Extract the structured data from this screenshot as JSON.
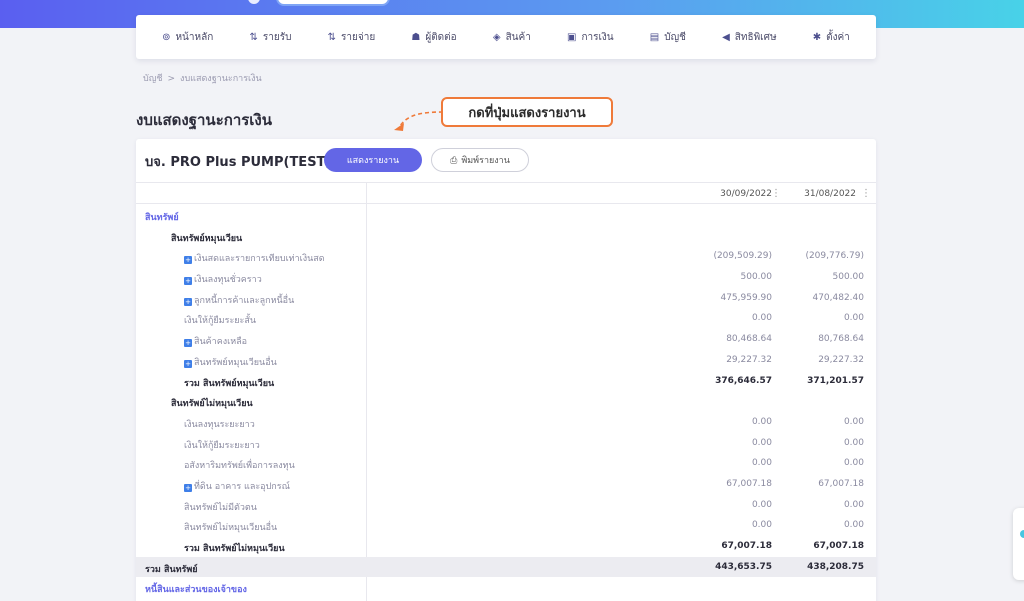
{
  "nav": [
    {
      "icon": "⊚",
      "label": "หน้าหลัก"
    },
    {
      "icon": "⇅",
      "label": "รายรับ"
    },
    {
      "icon": "⇅",
      "label": "รายจ่าย"
    },
    {
      "icon": "☗",
      "label": "ผู้ติดต่อ"
    },
    {
      "icon": "◈",
      "label": "สินค้า"
    },
    {
      "icon": "▣",
      "label": "การเงิน"
    },
    {
      "icon": "▤",
      "label": "บัญชี"
    },
    {
      "icon": "◀",
      "label": "สิทธิพิเศษ"
    },
    {
      "icon": "✱",
      "label": "ตั้งค่า"
    }
  ],
  "breadcrumb": {
    "root": "บัญชี",
    "sep": ">",
    "current": "งบแสดงฐานะการเงิน"
  },
  "page_title": "งบแสดงฐานะการเงิน",
  "callout": "กดที่ปุ่มแสดงรายงาน",
  "company": "บจ. PRO Plus PUMP(TEST)",
  "buttons": {
    "show": "แสดงรายงาน",
    "print": "พิมพ์รายงาน"
  },
  "columns": [
    "30/09/2022",
    "31/08/2022"
  ],
  "kebab": "⋮",
  "rows": [
    {
      "type": "lvl0",
      "label": "สินทรัพย์",
      "v1": "",
      "v2": ""
    },
    {
      "type": "lvl1",
      "label": "สินทรัพย์หมุนเวียน",
      "v1": "",
      "v2": ""
    },
    {
      "type": "lvl2",
      "plus": true,
      "label": "เงินสดและรายการเทียบเท่าเงินสด",
      "v1": "(209,509.29)",
      "v2": "(209,776.79)"
    },
    {
      "type": "lvl2",
      "plus": true,
      "label": "เงินลงทุนชั่วคราว",
      "v1": "500.00",
      "v2": "500.00"
    },
    {
      "type": "lvl2",
      "plus": true,
      "label": "ลูกหนี้การค้าและลูกหนี้อื่น",
      "v1": "475,959.90",
      "v2": "470,482.40"
    },
    {
      "type": "lvl2",
      "plus": false,
      "label": "เงินให้กู้ยืมระยะสั้น",
      "v1": "0.00",
      "v2": "0.00"
    },
    {
      "type": "lvl2",
      "plus": true,
      "label": "สินค้าคงเหลือ",
      "v1": "80,468.64",
      "v2": "80,768.64"
    },
    {
      "type": "lvl2",
      "plus": true,
      "label": "สินทรัพย์หมุนเวียนอื่น",
      "v1": "29,227.32",
      "v2": "29,227.32"
    },
    {
      "type": "tot",
      "label": "รวม สินทรัพย์หมุนเวียน",
      "v1": "376,646.57",
      "v2": "371,201.57"
    },
    {
      "type": "lvl1",
      "label": "สินทรัพย์ไม่หมุนเวียน",
      "v1": "",
      "v2": ""
    },
    {
      "type": "lvl2",
      "plus": false,
      "label": "เงินลงทุนระยะยาว",
      "v1": "0.00",
      "v2": "0.00"
    },
    {
      "type": "lvl2",
      "plus": false,
      "label": "เงินให้กู้ยืมระยะยาว",
      "v1": "0.00",
      "v2": "0.00"
    },
    {
      "type": "lvl2",
      "plus": false,
      "label": "อสังหาริมทรัพย์เพื่อการลงทุน",
      "v1": "0.00",
      "v2": "0.00"
    },
    {
      "type": "lvl2",
      "plus": true,
      "label": "ที่ดิน อาคาร และอุปกรณ์",
      "v1": "67,007.18",
      "v2": "67,007.18"
    },
    {
      "type": "lvl2",
      "plus": false,
      "label": "สินทรัพย์ไม่มีตัวตน",
      "v1": "0.00",
      "v2": "0.00"
    },
    {
      "type": "lvl2",
      "plus": false,
      "label": "สินทรัพย์ไม่หมุนเวียนอื่น",
      "v1": "0.00",
      "v2": "0.00"
    },
    {
      "type": "tot",
      "label": "รวม สินทรัพย์ไม่หมุนเวียน",
      "v1": "67,007.18",
      "v2": "67,007.18"
    },
    {
      "type": "grand",
      "label": "รวม สินทรัพย์",
      "v1": "443,653.75",
      "v2": "438,208.75"
    },
    {
      "type": "lvl0",
      "label": "หนี้สินและส่วนของเจ้าของ",
      "v1": "",
      "v2": ""
    }
  ]
}
